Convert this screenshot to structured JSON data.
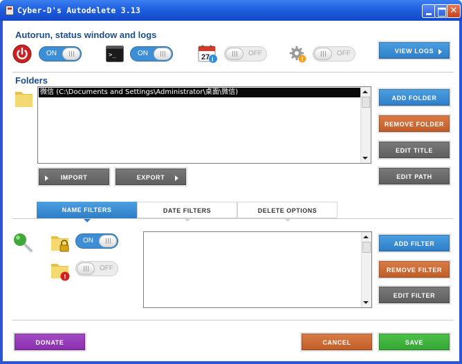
{
  "window": {
    "title": "Cyber-D's Autodelete 3.13"
  },
  "autorun": {
    "heading": "Autorun, status window and logs",
    "power_toggle": "ON",
    "console_toggle": "ON",
    "calendar_toggle": "OFF",
    "gear_toggle": "OFF",
    "calendar_day": "27",
    "view_logs_label": "VIEW LOGS"
  },
  "folders": {
    "heading": "Folders",
    "items": [
      "微信   (C:\\Documents and Settings\\Administrator\\桌面\\微信)"
    ],
    "add_label": "ADD FOLDER",
    "remove_label": "REMOVE FOLDER",
    "edit_title_label": "EDIT TITLE",
    "edit_path_label": "EDIT PATH",
    "import_label": "IMPORT",
    "export_label": "EXPORT"
  },
  "tabs": [
    "NAME FILTERS",
    "DATE FILTERS",
    "DELETE OPTIONS"
  ],
  "filters": {
    "locked_toggle": "ON",
    "warning_toggle": "OFF",
    "add_label": "ADD FILTER",
    "remove_label": "REMOVE FILTER",
    "edit_label": "EDIT FILTER"
  },
  "footer": {
    "donate_label": "DONATE",
    "cancel_label": "CANCEL",
    "save_label": "SAVE"
  },
  "colors": {
    "accent_blue": "#3d8ed4",
    "orange": "#c8652f",
    "gray": "#686868",
    "purple": "#9a3bbb",
    "green": "#40b43e",
    "heading": "#1b4d8c"
  }
}
